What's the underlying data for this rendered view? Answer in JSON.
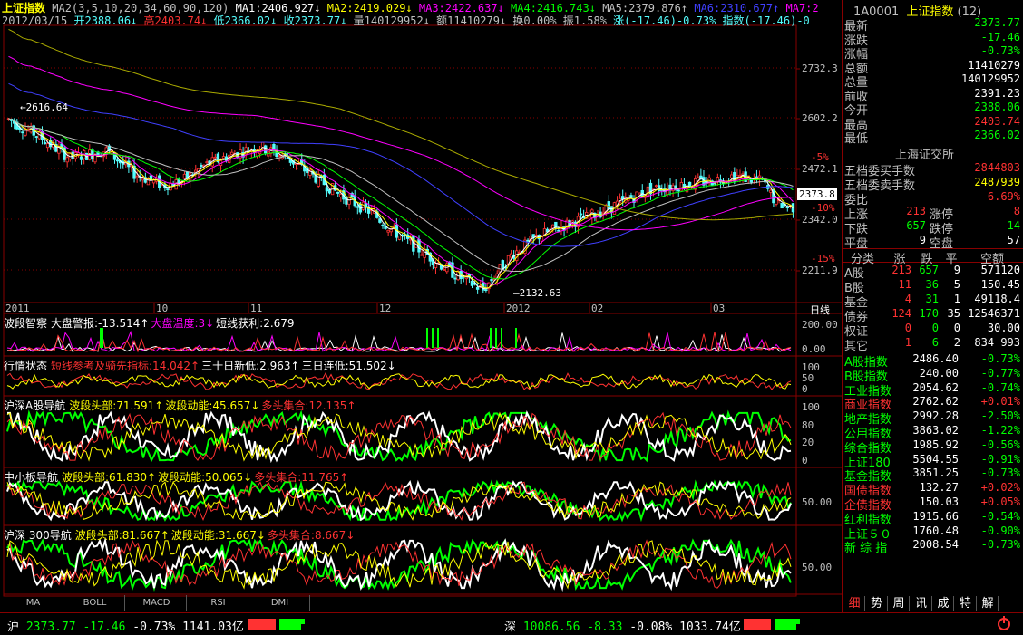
{
  "colors": {
    "up": "#ff3232",
    "down": "#54fcfc",
    "yellow": "#ffff00",
    "white": "#ffffff",
    "magenta": "#ff00ff",
    "green": "#00ff00",
    "blue": "#4040ff",
    "grid": "#880000",
    "axis": "#880000"
  },
  "header": {
    "title": "上证指数",
    "ma_line": "MA2(3,5,10,20,34,60,90,120)",
    "ma1": "MA1:2406.927↓",
    "ma2": "MA2:2419.029↓",
    "ma3": "MA3:2422.637↓",
    "ma4": "MA4:2416.743↓",
    "ma5": "MA5:2379.876↑",
    "ma6": "MA6:2310.677↑",
    "ma7": "MA7:2",
    "info": {
      "date": "2012/03/15",
      "open": "开2388.06↓",
      "high": "高2403.74↓",
      "low": "低2366.02↓",
      "close": "收2373.77↓",
      "vol": "量140129952↓",
      "amt": "额11410279↓",
      "turn": "换0.00%",
      "amp": "振1.58%",
      "chg": "涨(-17.46)-0.73%",
      "idx": "指数(-17.46)-0"
    }
  },
  "price_axis": {
    "labels": [
      "2732.3",
      "2602.2",
      "2472.1",
      "2342.0",
      "2211.9"
    ],
    "pct": [
      "-5%",
      "-10%",
      "-15%"
    ],
    "current": "2373.8"
  },
  "price_markers": {
    "high": "2616.64",
    "low": "2132.63"
  },
  "time_axis": {
    "labels": [
      "2011",
      "10",
      "11",
      "12",
      "2012",
      "02",
      "03"
    ],
    "period": "日线"
  },
  "indicators": [
    {
      "title": "波段智察",
      "items": [
        {
          "t": "大盘警报:-13.514↑",
          "c": "#ffffff"
        },
        {
          "t": "大盘温度:3↓",
          "c": "#ff00ff"
        },
        {
          "t": "短线获利:2.679",
          "c": "#ffffff"
        }
      ],
      "axis": [
        "200.00",
        "0.00"
      ]
    },
    {
      "title": "行情状态",
      "items": [
        {
          "t": "短线参考及骑先指标:14.042↑",
          "c": "#ff3232"
        },
        {
          "t": "三十日新低:2.963↑",
          "c": "#ffffff"
        },
        {
          "t": "三日连低:51.502↓",
          "c": "#ffffff"
        }
      ],
      "axis": [
        "100",
        "50",
        "0"
      ]
    },
    {
      "title": "沪深A股导航",
      "items": [
        {
          "t": "波段头部:71.591↑",
          "c": "#ffff00"
        },
        {
          "t": "波段动能:45.657↓",
          "c": "#ffff00"
        },
        {
          "t": "多头集合:12.135↑",
          "c": "#ff3232"
        }
      ],
      "axis": [
        "100",
        "80",
        "20",
        "0"
      ]
    },
    {
      "title": "中小板导航",
      "items": [
        {
          "t": "波段头部:61.830↑",
          "c": "#ffff00"
        },
        {
          "t": "波段动能:50.065↓",
          "c": "#ffff00"
        },
        {
          "t": "多头集合:11.765↑",
          "c": "#ff3232"
        }
      ],
      "axis": [
        "50.00"
      ]
    },
    {
      "title": "沪深 300导航",
      "items": [
        {
          "t": "波段头部:81.667↑",
          "c": "#ffff00"
        },
        {
          "t": "波段动能:31.667↓",
          "c": "#ffff00"
        },
        {
          "t": "多头集合:8.667↓",
          "c": "#ff3232"
        }
      ],
      "axis": [
        "50.00"
      ]
    }
  ],
  "bottom_tabs": [
    "MA",
    "BOLL",
    "MACD",
    "RSI",
    "DMI"
  ],
  "quote": {
    "code": "1A0001",
    "name": "上证指数",
    "count": "(12)",
    "rows": [
      {
        "l": "最新",
        "v": "2373.77",
        "c": "#00ff00"
      },
      {
        "l": "涨跌",
        "v": "-17.46",
        "c": "#00ff00"
      },
      {
        "l": "涨幅",
        "v": "-0.73%",
        "c": "#00ff00"
      },
      {
        "l": "总额",
        "v": "11410279",
        "c": "#ffffff"
      },
      {
        "l": "总量",
        "v": "140129952",
        "c": "#ffffff"
      },
      {
        "l": "前收",
        "v": "2391.23",
        "c": "#ffffff"
      },
      {
        "l": "今开",
        "v": "2388.06",
        "c": "#00ff00"
      },
      {
        "l": "最高",
        "v": "2403.74",
        "c": "#ff3232"
      },
      {
        "l": "最低",
        "v": "2366.02",
        "c": "#00ff00"
      }
    ],
    "exchange": "上海证交所",
    "orders": [
      {
        "l": "五档委买手数",
        "v": "2844803",
        "c": "#ff3232"
      },
      {
        "l": "五档委卖手数",
        "v": "2487939",
        "c": "#ffff00"
      },
      {
        "l": "委比",
        "v": "6.69%",
        "c": "#ff3232"
      }
    ],
    "breadth": [
      {
        "l1": "上涨",
        "v1": "213",
        "c1": "#ff3232",
        "l2": "涨停",
        "v2": "8",
        "c2": "#ff3232"
      },
      {
        "l1": "下跌",
        "v1": "657",
        "c1": "#00ff00",
        "l2": "跌停",
        "v2": "14",
        "c2": "#00ff00"
      },
      {
        "l1": "平盘",
        "v1": "9",
        "c1": "#ffffff",
        "l2": "空盘",
        "v2": "57",
        "c2": "#ffffff"
      }
    ],
    "table_head": [
      "分类",
      "涨",
      "跌",
      "平",
      "空额"
    ],
    "table": [
      [
        "A股",
        "213",
        "657",
        "9",
        "571120"
      ],
      [
        "B股",
        "11",
        "36",
        "5",
        "150.45"
      ],
      [
        "基金",
        "4",
        "31",
        "1",
        "49118.4"
      ],
      [
        "债券",
        "124",
        "170",
        "35",
        "12546371"
      ],
      [
        "权证",
        "0",
        "0",
        "0",
        "30.00"
      ],
      [
        "其它",
        "1",
        "6",
        "2",
        "834 993"
      ]
    ],
    "indices": [
      {
        "n": "A股指数",
        "v": "2486.40",
        "p": "-0.73%",
        "c": "#00ff00"
      },
      {
        "n": "B股指数",
        "v": "240.00",
        "p": "-0.77%",
        "c": "#00ff00"
      },
      {
        "n": "工业指数",
        "v": "2054.62",
        "p": "-0.74%",
        "c": "#00ff00"
      },
      {
        "n": "商业指数",
        "v": "2762.62",
        "p": "+0.01%",
        "c": "#ff3232"
      },
      {
        "n": "地产指数",
        "v": "2992.28",
        "p": "-2.50%",
        "c": "#00ff00"
      },
      {
        "n": "公用指数",
        "v": "3863.02",
        "p": "-1.22%",
        "c": "#00ff00"
      },
      {
        "n": "综合指数",
        "v": "1985.92",
        "p": "-0.56%",
        "c": "#00ff00"
      },
      {
        "n": "上证180",
        "v": "5504.55",
        "p": "-0.91%",
        "c": "#00ff00"
      },
      {
        "n": "基金指数",
        "v": "3851.25",
        "p": "-0.73%",
        "c": "#00ff00"
      },
      {
        "n": "国债指数",
        "v": "132.27",
        "p": "+0.02%",
        "c": "#ff3232"
      },
      {
        "n": "企债指数",
        "v": "150.03",
        "p": "+0.05%",
        "c": "#ff3232"
      },
      {
        "n": "红利指数",
        "v": "1915.66",
        "p": "-0.54%",
        "c": "#00ff00"
      },
      {
        "n": "上证５０",
        "v": "1760.48",
        "p": "-0.90%",
        "c": "#00ff00"
      },
      {
        "n": "新 综 指",
        "v": "2008.54",
        "p": "-0.73%",
        "c": "#00ff00"
      }
    ],
    "tabs": [
      "细",
      "势",
      "周",
      "讯",
      "成",
      "特",
      "解"
    ]
  },
  "status": {
    "sh_label": "沪",
    "sh_price": "2373.77",
    "sh_chg": "-17.46",
    "sh_pct": "-0.73%",
    "sh_amt": "1141.03亿",
    "sz_label": "深",
    "sz_price": "10086.56",
    "sz_chg": "-8.33",
    "sz_pct": "-0.08%",
    "sz_amt": "1033.74亿"
  }
}
